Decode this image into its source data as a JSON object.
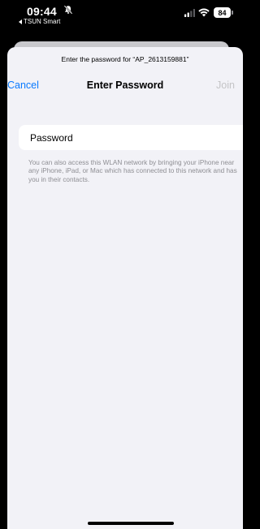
{
  "status_bar": {
    "time": "09:44",
    "back_app": "TSUN Smart",
    "battery": "84"
  },
  "sheet": {
    "prompt": "Enter the password for “AP_2613159881”",
    "nav": {
      "cancel": "Cancel",
      "title": "Enter Password",
      "join": "Join"
    },
    "password_field": {
      "placeholder": "Password",
      "value": ""
    },
    "help_text": "You can also access this WLAN network by bringing your iPhone near any iPhone, iPad, or Mac which has connected to this network and has you in their contacts."
  },
  "colors": {
    "accent": "#0a7aff",
    "disabled": "#c4c4c6",
    "secondary_text": "#8e8e93",
    "sheet_background": "#f2f2f7"
  },
  "icons": [
    "silent-bell-icon",
    "back-arrow-icon",
    "cellular-signal-icon",
    "wifi-icon",
    "battery-icon"
  ]
}
